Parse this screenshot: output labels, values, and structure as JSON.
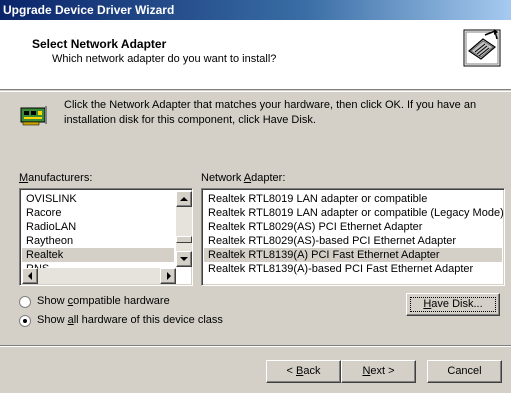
{
  "window": {
    "title": "Upgrade Device Driver Wizard"
  },
  "header": {
    "title": "Select Network Adapter",
    "subtitle": "Which network adapter do you want to install?"
  },
  "instructions": {
    "line1": "Click the Network Adapter that matches your hardware, then click OK. If you have an",
    "line2": "installation disk for this component, click Have Disk."
  },
  "manufacturers": {
    "label_pre": "",
    "label_accel": "M",
    "label_post": "anufacturers:",
    "items": [
      "OVISLINK",
      "Racore",
      "RadioLAN",
      "Raytheon",
      "Realtek",
      "RNS"
    ],
    "selected": "Realtek"
  },
  "adapters": {
    "label_pre": "Network ",
    "label_accel": "A",
    "label_post": "dapter:",
    "items": [
      "Realtek RTL8019 LAN adapter or compatible",
      "Realtek RTL8019 LAN adapter or compatible (Legacy Mode)",
      "Realtek RTL8029(AS) PCI Ethernet Adapter",
      "Realtek RTL8029(AS)-based PCI Ethernet Adapter",
      "Realtek RTL8139(A) PCI Fast Ethernet Adapter",
      "Realtek RTL8139(A)-based PCI Fast Ethernet Adapter"
    ],
    "selected": "Realtek RTL8139(A) PCI Fast Ethernet Adapter"
  },
  "options": {
    "compatible": {
      "pre": "Show ",
      "accel": "c",
      "post": "ompatible hardware",
      "checked": false
    },
    "all": {
      "pre": "Show ",
      "accel": "a",
      "post": "ll hardware of this device class",
      "checked": true
    }
  },
  "buttons": {
    "have_disk": {
      "pre": "",
      "accel": "H",
      "post": "ave Disk..."
    },
    "back": {
      "pre": "< ",
      "accel": "B",
      "post": "ack"
    },
    "next": {
      "pre": "",
      "accel": "N",
      "post": "ext >"
    },
    "cancel": {
      "pre": "",
      "accel": "",
      "post": "Cancel"
    }
  }
}
